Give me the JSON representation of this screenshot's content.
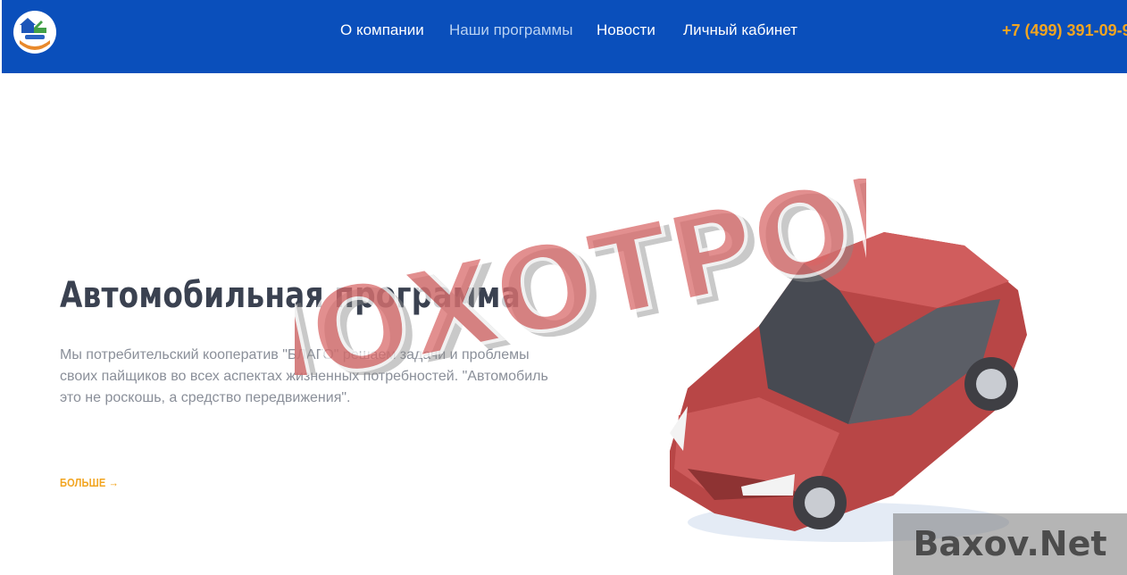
{
  "header": {
    "logo": {
      "icon": "house-car-hand-logo"
    },
    "nav": [
      {
        "label": "О компании",
        "active": false
      },
      {
        "label": "Наши программы",
        "active": true
      },
      {
        "label": "Новости",
        "active": false
      },
      {
        "label": "Личный кабинет",
        "active": false
      }
    ],
    "phone": "+7 (499) 391-09-9"
  },
  "hero": {
    "title": "Автомобильная программа",
    "description": "Мы потребительский кооператив \"БЛАГО\" решаем задачи и проблемы своих пайщиков во всех аспектах жизненных потребностей. \"Автомобиль это не роскошь, а средство передвижения\".",
    "more_label": "БОЛЬШЕ →"
  },
  "overlay": {
    "stamp_text": "ЛОХОТРОН",
    "watermark_text": "Baxov.Net"
  },
  "colors": {
    "header_bg": "#0a4fbb",
    "accent": "#f2a521",
    "car": "#c95454",
    "stamp": "#d96a6a"
  }
}
